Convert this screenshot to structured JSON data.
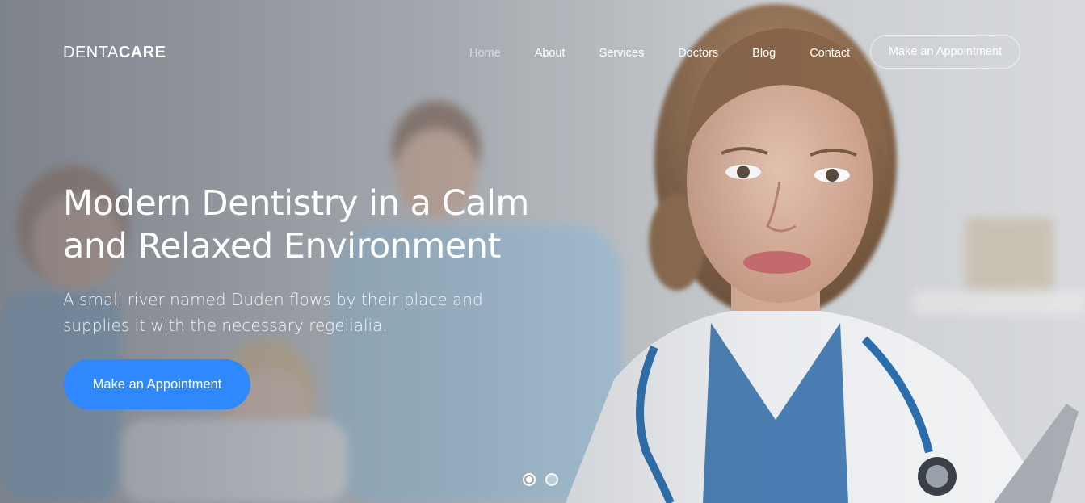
{
  "brand": {
    "part1": "DENTA",
    "part2": "CARE"
  },
  "nav": {
    "items": [
      {
        "label": "Home",
        "active": true
      },
      {
        "label": "About",
        "active": false
      },
      {
        "label": "Services",
        "active": false
      },
      {
        "label": "Doctors",
        "active": false
      },
      {
        "label": "Blog",
        "active": false
      },
      {
        "label": "Contact",
        "active": false
      }
    ],
    "cta_label": "Make an Appointment"
  },
  "hero": {
    "headline": "Modern Dentistry in a Calm and Relaxed Environment",
    "subtext": "A small river named Duden flows by their place and supplies it with the necessary regelialia.",
    "cta_label": "Make an Appointment",
    "cta_color": "#2f89fc"
  },
  "carousel": {
    "slide_count": 2,
    "active_index": 0
  }
}
